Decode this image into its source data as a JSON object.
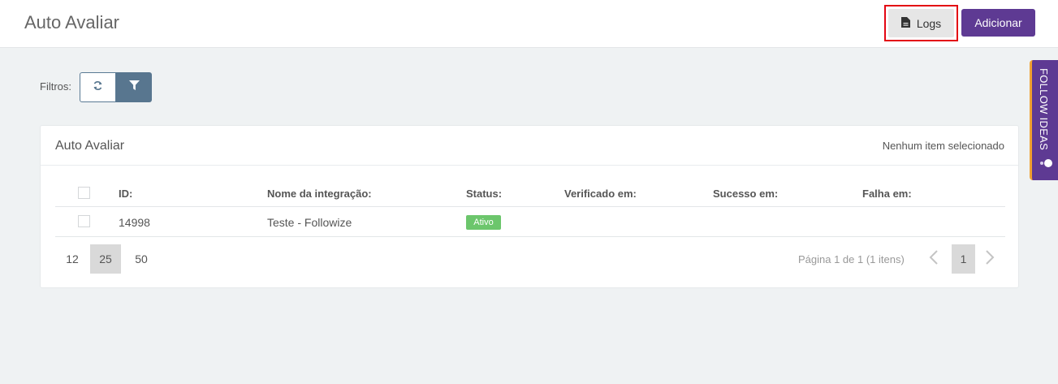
{
  "header": {
    "title": "Auto Avaliar",
    "logs_label": "Logs",
    "add_label": "Adicionar"
  },
  "filters": {
    "label": "Filtros:"
  },
  "panel": {
    "title": "Auto Avaliar",
    "selection_status": "Nenhum item selecionado"
  },
  "table": {
    "columns": [
      "ID:",
      "Nome da integração:",
      "Status:",
      "Verificado em:",
      "Sucesso em:",
      "Falha em:"
    ],
    "rows": [
      {
        "id": "14998",
        "name": "Teste - Followize",
        "status": "Ativo",
        "verified": "",
        "success": "",
        "failure": ""
      }
    ]
  },
  "pagination": {
    "page_sizes": [
      "12",
      "25",
      "50"
    ],
    "selected_size": "25",
    "info": "Página 1 de 1 (1 itens)",
    "current_page": "1"
  },
  "side_tab": {
    "label": "FOLLOW IDEAS"
  },
  "colors": {
    "accent": "#5e3a93",
    "highlight_border": "#e30613",
    "status_active": "#6cc66c",
    "filter_button": "#58768f"
  },
  "icons": {
    "logs": "file-icon",
    "refresh": "refresh-icon",
    "filter": "filter-icon",
    "prev": "chevron-left-icon",
    "next": "chevron-right-icon",
    "side_tab": "toggle-icon"
  }
}
